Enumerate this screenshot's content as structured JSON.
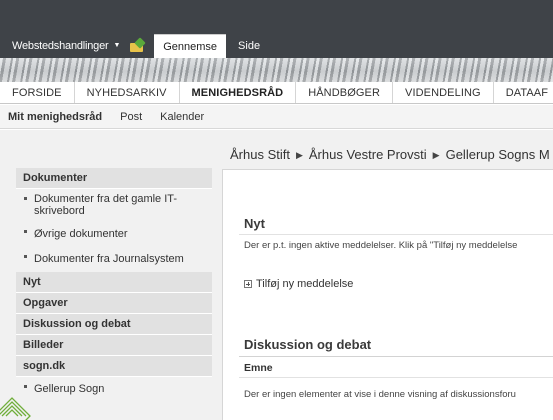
{
  "ribbon": {
    "site_actions": "Webstedshandlinger",
    "tabs": [
      {
        "label": "Gennemse",
        "active": true
      },
      {
        "label": "Side",
        "active": false
      }
    ]
  },
  "topnav": {
    "items": [
      {
        "label": "FORSIDE",
        "active": false
      },
      {
        "label": "NYHEDSARKIV",
        "active": false
      },
      {
        "label": "MENIGHEDSRÅD",
        "active": true
      },
      {
        "label": "HÅNDBØGER",
        "active": false
      },
      {
        "label": "VIDENDELING",
        "active": false
      },
      {
        "label": "DATAAF",
        "active": false
      }
    ]
  },
  "subnav": {
    "items": [
      "Mit menighedsråd",
      "Post",
      "Kalender"
    ]
  },
  "breadcrumb": {
    "items": [
      "Århus Stift",
      "Århus Vestre Provsti",
      "Gellerup Sogns M"
    ]
  },
  "leftnav": {
    "dokumenter": "Dokumenter",
    "dokumenter_items": [
      "Dokumenter fra det gamle IT-skrivebord",
      "Øvrige dokumenter",
      "Dokumenter fra Journalsystem"
    ],
    "nyt": "Nyt",
    "opgaver": "Opgaver",
    "diskussion": "Diskussion og debat",
    "billeder": "Billeder",
    "sogn": "sogn.dk",
    "sogn_items": [
      "Gellerup Sogn"
    ]
  },
  "main": {
    "nyt_title": "Nyt",
    "nyt_empty": "Der er p.t. ingen aktive meddelelser. Klik på \"Tilføj ny meddelelse",
    "add_link": "Tilføj ny meddelelse",
    "disc_title": "Diskussion og debat",
    "col_emne": "Emne",
    "disc_empty": "Der er ingen elementer at vise i denne visning af diskussionsforu"
  },
  "colors": {
    "ribbon_bg": "#3f4348",
    "nav_head_bg": "#e1e1e1",
    "content_bg": "#f1f1f1"
  }
}
